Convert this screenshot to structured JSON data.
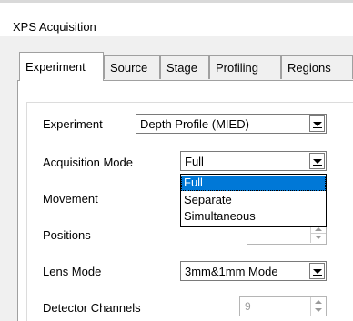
{
  "window": {
    "title": "XPS Acquisition"
  },
  "tabs": [
    {
      "label": "Experiment",
      "selected": true
    },
    {
      "label": "Source",
      "selected": false
    },
    {
      "label": "Stage",
      "selected": false
    },
    {
      "label": "Profiling",
      "selected": false
    },
    {
      "label": "Regions",
      "selected": false
    }
  ],
  "form": {
    "experiment": {
      "label": "Experiment",
      "value": "Depth Profile (MIED)"
    },
    "acquisition_mode": {
      "label": "Acquisition Mode",
      "value": "Full"
    },
    "movement": {
      "label": "Movement"
    },
    "positions": {
      "label": "Positions"
    },
    "lens_mode": {
      "label": "Lens Mode",
      "value": "3mm&1mm Mode"
    },
    "detector_channels": {
      "label": "Detector Channels",
      "value": "9"
    }
  },
  "dropdown": {
    "options": [
      "Full",
      "Separate",
      "Simultaneous"
    ],
    "highlighted": "Full"
  },
  "colors": {
    "highlight": "#0078d7",
    "window_bg": "#f0f0f0"
  }
}
